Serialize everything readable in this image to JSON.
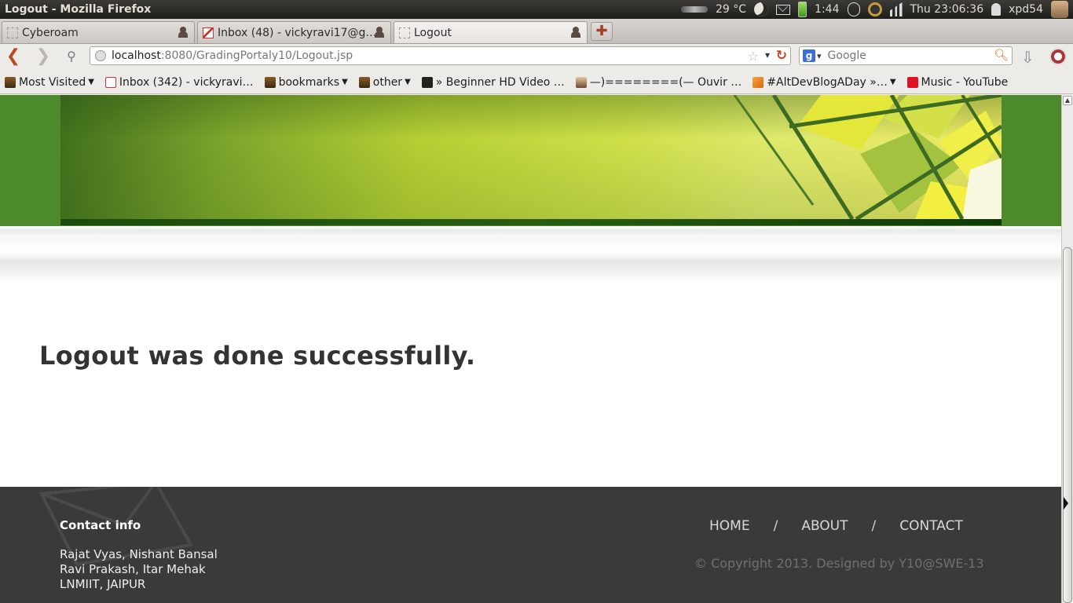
{
  "window": {
    "title": "Logout - Mozilla Firefox"
  },
  "indicators": {
    "weather": "29 °C",
    "battery_time": "1:44",
    "clock": "Thu 23:06:36",
    "user": "xpd54"
  },
  "tabs": [
    {
      "label": "Cyberoam",
      "active": false
    },
    {
      "label": "Inbox (48) - vickyravi17@g…",
      "active": false
    },
    {
      "label": "Logout",
      "active": true
    }
  ],
  "toolbar": {
    "url_host": "localhost",
    "url_path": ":8080/GradingPortaly10/Logout.jsp",
    "search_placeholder": "Google"
  },
  "bookmarks": [
    {
      "label": "Most Visited",
      "icon": "folder-icon",
      "dropdown": true
    },
    {
      "label": "Inbox (342) - vickyravi…",
      "icon": "gmail-icon",
      "dropdown": false
    },
    {
      "label": "bookmarks",
      "icon": "folder-icon",
      "dropdown": true
    },
    {
      "label": "other",
      "icon": "folder-icon",
      "dropdown": true
    },
    {
      "label": "» Beginner HD Video …",
      "icon": "site-icon",
      "dropdown": false
    },
    {
      "label": "—)========(— Ouvir …",
      "icon": "face-icon",
      "dropdown": false
    },
    {
      "label": "#AltDevBlogADay »…",
      "icon": "rss-icon",
      "dropdown": true
    },
    {
      "label": "Music - YouTube",
      "icon": "youtube-icon",
      "dropdown": false
    }
  ],
  "page": {
    "message": "Logout was done successfully.",
    "footer": {
      "contact_title": "Contact info",
      "contact_lines": [
        "Rajat Vyas, Nishant Bansal",
        "Ravi Prakash, Itar Mehak",
        "LNMIIT, JAIPUR"
      ],
      "nav": [
        "HOME",
        "ABOUT",
        "CONTACT"
      ],
      "nav_separator": "/",
      "copyright": "© Copyright 2013. Designed by Y10@SWE-13"
    }
  },
  "colors": {
    "header_green": "#4c8a2b",
    "footer_bg": "#3a3a3a",
    "heading": "#333333"
  }
}
